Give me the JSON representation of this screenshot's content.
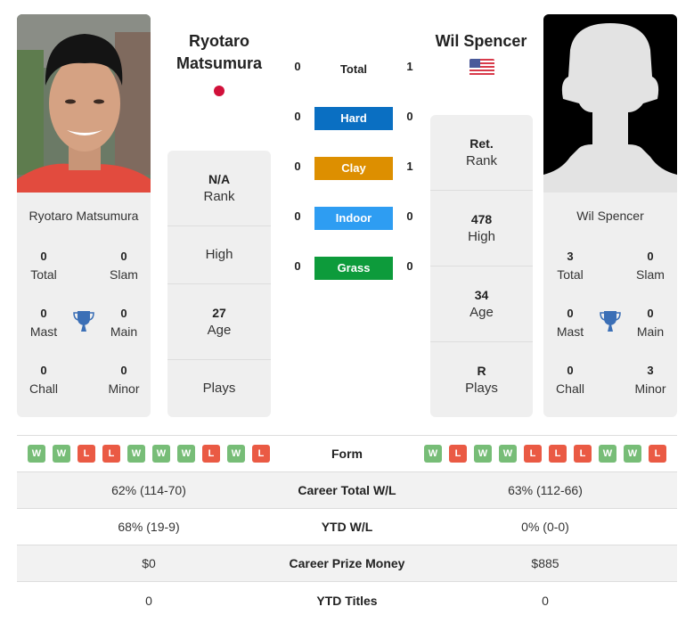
{
  "player1": {
    "name_line1": "Ryotaro",
    "name_line2": "Matsumura",
    "full_name": "Ryotaro Matsumura",
    "country_color": "#d1103a",
    "titles": {
      "total": "0",
      "total_label": "Total",
      "slam": "0",
      "slam_label": "Slam",
      "mast": "0",
      "mast_label": "Mast",
      "main": "0",
      "main_label": "Main",
      "chall": "0",
      "chall_label": "Chall",
      "minor": "0",
      "minor_label": "Minor"
    },
    "info": {
      "rank": "N/A",
      "rank_label": "Rank",
      "high": "",
      "high_label": "High",
      "age": "27",
      "age_label": "Age",
      "plays": "",
      "plays_label": "Plays"
    },
    "form": [
      "W",
      "W",
      "L",
      "L",
      "W",
      "W",
      "W",
      "L",
      "W",
      "L"
    ]
  },
  "player2": {
    "name": "Wil Spencer",
    "full_name": "Wil Spencer",
    "country": "USA",
    "titles": {
      "total": "3",
      "total_label": "Total",
      "slam": "0",
      "slam_label": "Slam",
      "mast": "0",
      "mast_label": "Mast",
      "main": "0",
      "main_label": "Main",
      "chall": "0",
      "chall_label": "Chall",
      "minor": "3",
      "minor_label": "Minor"
    },
    "info": {
      "rank": "Ret.",
      "rank_label": "Rank",
      "high": "478",
      "high_label": "High",
      "age": "34",
      "age_label": "Age",
      "plays": "R",
      "plays_label": "Plays"
    },
    "form": [
      "W",
      "L",
      "W",
      "W",
      "L",
      "L",
      "L",
      "W",
      "W",
      "L"
    ]
  },
  "h2h": {
    "total": {
      "label": "Total",
      "p1": "0",
      "p2": "1"
    },
    "surfaces": [
      {
        "label": "Hard",
        "p1": "0",
        "p2": "0",
        "color": "#0a6fc2"
      },
      {
        "label": "Clay",
        "p1": "0",
        "p2": "1",
        "color": "#dd8f00"
      },
      {
        "label": "Indoor",
        "p1": "0",
        "p2": "0",
        "color": "#2e9df2"
      },
      {
        "label": "Grass",
        "p1": "0",
        "p2": "0",
        "color": "#0d9b3b"
      }
    ]
  },
  "colors": {
    "win": "#77bd77",
    "loss": "#ea5a44",
    "trophy": "#3b6fb6"
  },
  "stats": {
    "form_label": "Form",
    "rows": [
      {
        "label": "Career Total W/L",
        "p1": "62% (114-70)",
        "p2": "63% (112-66)"
      },
      {
        "label": "YTD W/L",
        "p1": "68% (19-9)",
        "p2": "0% (0-0)"
      },
      {
        "label": "Career Prize Money",
        "p1": "$0",
        "p2": "$885"
      },
      {
        "label": "YTD Titles",
        "p1": "0",
        "p2": "0"
      }
    ]
  }
}
